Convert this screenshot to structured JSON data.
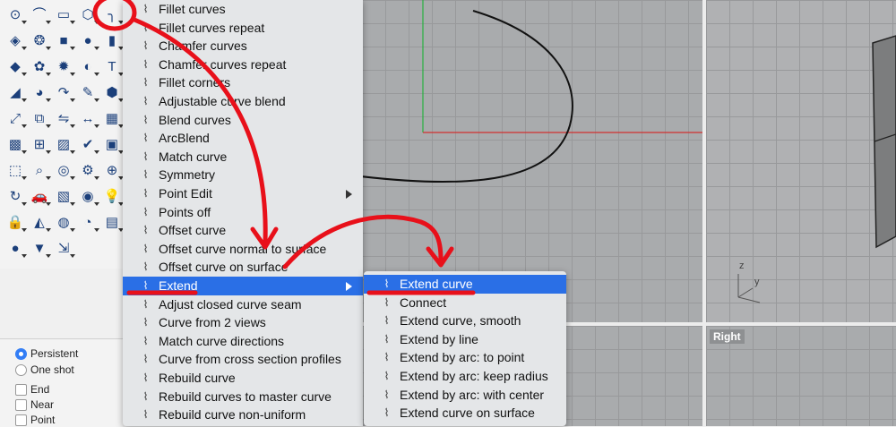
{
  "main_menu": {
    "items": [
      {
        "label": "Fillet curves",
        "icon": "fillet-icon"
      },
      {
        "label": "Fillet curves repeat",
        "icon": "fillet-repeat-icon"
      },
      {
        "label": "Chamfer curves",
        "icon": "chamfer-icon"
      },
      {
        "label": "Chamfer curves repeat",
        "icon": "chamfer-repeat-icon"
      },
      {
        "label": "Fillet corners",
        "icon": "fillet-corners-icon"
      },
      {
        "label": "Adjustable curve blend",
        "icon": "curve-blend-icon"
      },
      {
        "label": "Blend curves",
        "icon": "blend-curves-icon"
      },
      {
        "label": "ArcBlend",
        "icon": "arc-blend-icon"
      },
      {
        "label": "Match curve",
        "icon": "match-curve-icon"
      },
      {
        "label": "Symmetry",
        "icon": "symmetry-icon"
      },
      {
        "label": "Point Edit",
        "icon": "point-edit-icon",
        "submenu": true
      },
      {
        "label": "Points off",
        "icon": "points-off-icon"
      },
      {
        "label": "Offset curve",
        "icon": "offset-curve-icon"
      },
      {
        "label": "Offset curve normal to surface",
        "icon": "offset-normal-icon"
      },
      {
        "label": "Offset curve on surface",
        "icon": "offset-on-surface-icon"
      },
      {
        "label": "Extend",
        "icon": "extend-icon",
        "submenu": true,
        "highlighted": true
      },
      {
        "label": "Adjust closed curve seam",
        "icon": "seam-icon"
      },
      {
        "label": "Curve from 2 views",
        "icon": "two-views-icon"
      },
      {
        "label": "Match curve directions",
        "icon": "directions-icon"
      },
      {
        "label": "Curve from cross section profiles",
        "icon": "cross-section-icon"
      },
      {
        "label": "Rebuild curve",
        "icon": "rebuild-icon"
      },
      {
        "label": "Rebuild curves to master curve",
        "icon": "rebuild-master-icon"
      },
      {
        "label": "Rebuild curve non-uniform",
        "icon": "rebuild-nonuniform-icon"
      }
    ]
  },
  "sub_menu": {
    "items": [
      {
        "label": "Extend curve",
        "icon": "extend-curve-icon",
        "highlighted": true
      },
      {
        "label": "Connect",
        "icon": "connect-icon"
      },
      {
        "label": "Extend curve, smooth",
        "icon": "extend-smooth-icon"
      },
      {
        "label": "Extend by line",
        "icon": "extend-line-icon"
      },
      {
        "label": "Extend by arc: to point",
        "icon": "extend-arc-point-icon"
      },
      {
        "label": "Extend by arc: keep radius",
        "icon": "extend-arc-radius-icon"
      },
      {
        "label": "Extend by arc: with center",
        "icon": "extend-arc-center-icon"
      },
      {
        "label": "Extend curve on surface",
        "icon": "extend-on-surface-icon"
      }
    ]
  },
  "osnap": {
    "radios": [
      {
        "label": "Persistent",
        "checked": true
      },
      {
        "label": "One shot",
        "checked": false
      }
    ],
    "checks": [
      {
        "label": "End",
        "checked": false
      },
      {
        "label": "Near",
        "checked": false
      },
      {
        "label": "Point",
        "checked": false
      }
    ]
  },
  "viewports": {
    "right_label": "Right",
    "axis_z": "z",
    "axis_y": "y"
  },
  "toolbar_icons": [
    "point-icon",
    "curve-icon",
    "rectangle-icon",
    "polygon-icon",
    "fillet-icon",
    "surface-icon",
    "revolve-icon",
    "box-icon",
    "sphere-icon",
    "cylinder-icon",
    "surface-edit-icon",
    "gear-icon",
    "explode-icon",
    "boolean-icon",
    "text-icon",
    "paint-icon",
    "shade-icon",
    "arc-icon",
    "pencil-icon",
    "solid-icon",
    "move-icon",
    "transform-icon",
    "mirror-icon",
    "dimension-icon",
    "array-icon",
    "grid-icon",
    "cabinet-icon",
    "block-icon",
    "check-icon",
    "cube-icon",
    "transform-3d-icon",
    "zoom-icon",
    "target-icon",
    "gear-settings-icon",
    "snap-icon",
    "rotate-view-icon",
    "car-icon",
    "map-icon",
    "render-icon",
    "lightbulb-icon",
    "lock-icon",
    "layer-icon",
    "color-wheel-icon",
    "sun-icon",
    "film-icon",
    "globe-icon",
    "light-icon",
    "cursor-icon"
  ],
  "colors": {
    "highlight": "#2a6fe6",
    "annotation": "#e8101a",
    "x_axis": "#d23030",
    "y_axis": "#28b040"
  }
}
